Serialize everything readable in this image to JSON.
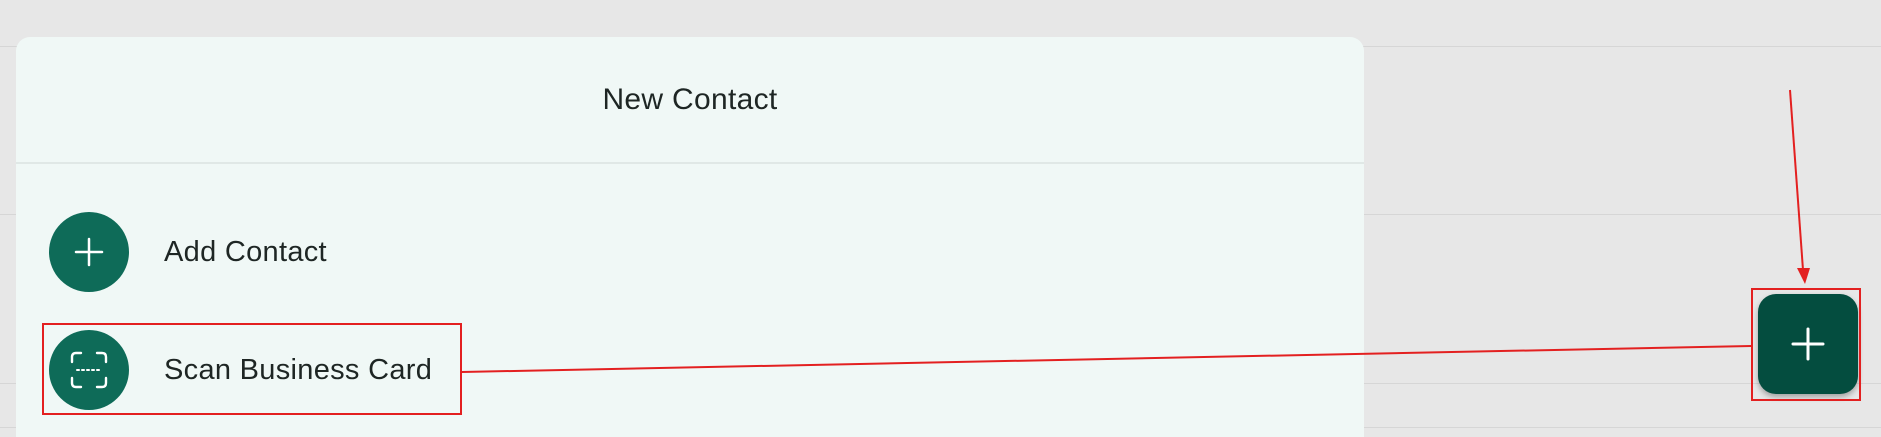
{
  "sheet": {
    "title": "New Contact",
    "items": [
      {
        "label": "Add Contact",
        "icon": "plus-icon"
      },
      {
        "label": "Scan Business Card",
        "icon": "scan-icon"
      }
    ]
  },
  "fab": {
    "icon": "plus-icon"
  },
  "colors": {
    "accent": "#0e6b58",
    "fab": "#044d3f",
    "sheet_background": "#f0f8f6",
    "page_background": "#e7e7e7",
    "annotation": "#e32020"
  }
}
